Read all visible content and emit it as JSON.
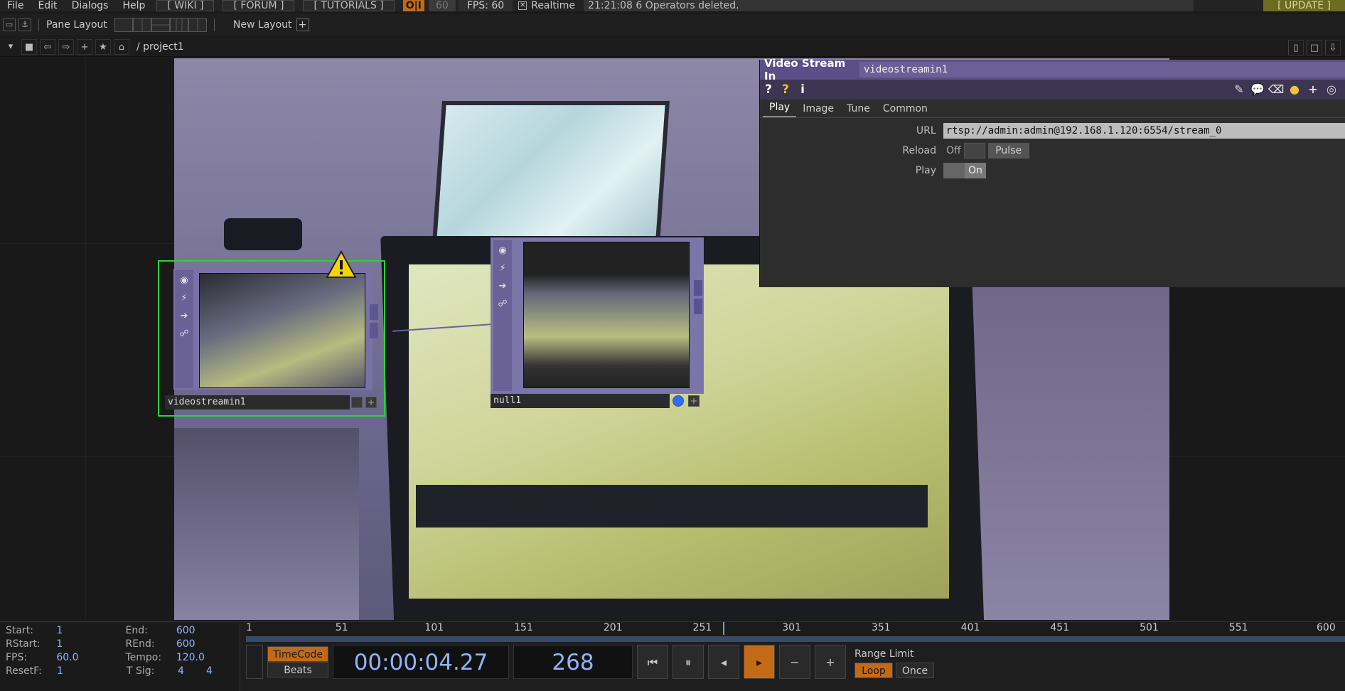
{
  "menubar": {
    "items": [
      "File",
      "Edit",
      "Dialogs",
      "Help"
    ],
    "links": [
      "[ WIKI ]",
      "[ FORUM ]",
      "[ TUTORIALS ]"
    ],
    "oi_label": "O|I",
    "fps_cap": "60",
    "fps_label": "FPS:",
    "fps_value": "60",
    "realtime_label": "Realtime",
    "status_message": "21:21:08 6 Operators deleted.",
    "update_label": "[ UPDATE ]"
  },
  "panebar": {
    "pane_layout_label": "Pane Layout",
    "new_layout_label": "New Layout"
  },
  "pathbar": {
    "path": "/ project1"
  },
  "nodes": {
    "videostreamin": {
      "name": "videostreamin1"
    },
    "null": {
      "name": "null1"
    }
  },
  "params": {
    "operator_type": "Video Stream In",
    "operator_name": "videostreamin1",
    "tabs": [
      "Play",
      "Image",
      "Tune",
      "Common"
    ],
    "active_tab": "Play",
    "url_label": "URL",
    "url_value": "rtsp://admin:admin@192.168.1.120:6554/stream_0",
    "reload_label": "Reload",
    "reload_off": "Off",
    "pulse_label": "Pulse",
    "play_label": "Play",
    "play_on": "On"
  },
  "timeline": {
    "ruler": [
      "1",
      "51",
      "101",
      "151",
      "201",
      "251",
      "301",
      "351",
      "401",
      "451",
      "501",
      "551",
      "600"
    ],
    "info": {
      "start_label": "Start:",
      "start": "1",
      "end_label": "End:",
      "end": "600",
      "rstart_label": "RStart:",
      "rstart": "1",
      "rend_label": "REnd:",
      "rend": "600",
      "fps_label": "FPS:",
      "fps": "60.0",
      "tempo_label": "Tempo:",
      "tempo": "120.0",
      "resetf_label": "ResetF:",
      "resetf": "1",
      "tsig_label": "T Sig:",
      "tsig_a": "4",
      "tsig_b": "4"
    },
    "timecode_label": "TimeCode",
    "beats_label": "Beats",
    "time": "00:00:04.27",
    "frame": "268",
    "range_limit_label": "Range Limit",
    "loop_label": "Loop",
    "once_label": "Once"
  },
  "colors": {
    "accent": "#c46a17",
    "selection": "#2fd23a",
    "panel_header": "#5a4f86",
    "time_text": "#8fb4ff"
  }
}
